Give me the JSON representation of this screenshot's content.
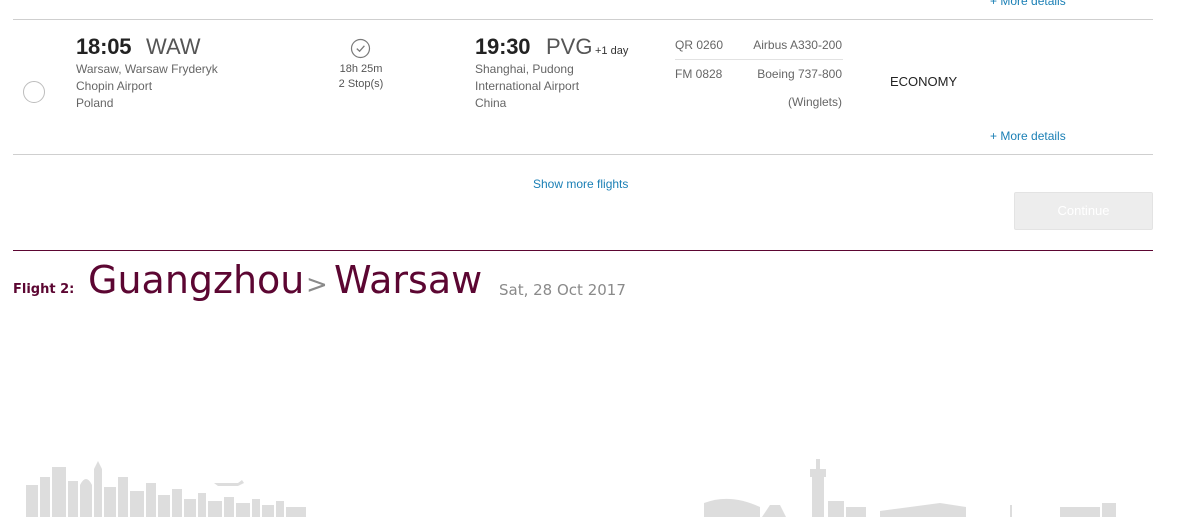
{
  "top_link": "+ More details",
  "flight_option": {
    "dep_time": "18:05",
    "dep_code": "WAW",
    "dep_place": [
      "Warsaw, Warsaw Fryderyk",
      "Chopin Airport",
      "Poland"
    ],
    "duration": "18h 25m",
    "stops": "2 Stop(s)",
    "arr_time": "19:30",
    "arr_code": "PVG",
    "arr_offset": "+1 day",
    "arr_place": [
      "Shanghai, Pudong",
      "International Airport",
      "China"
    ],
    "segments": [
      {
        "flight": "QR 0260",
        "aircraft": "Airbus A330-200"
      },
      {
        "flight": "FM 0828",
        "aircraft": "Boeing 737-800",
        "aircraft_note": "(Winglets)"
      }
    ],
    "cabin": "ECONOMY",
    "more_details": "+ More details"
  },
  "show_more": "Show more flights",
  "continue_label": "Continue",
  "flight2": {
    "label": "Flight 2:",
    "origin": "Guangzhou",
    "separator": ">",
    "destination": "Warsaw",
    "date": "Sat, 28 Oct 2017"
  },
  "colors": {
    "brand": "#5c0632",
    "link": "#1a7fb5",
    "skyline": "#dddddd"
  },
  "icons": {
    "clock": "clock-icon",
    "radio": "radio-button"
  }
}
